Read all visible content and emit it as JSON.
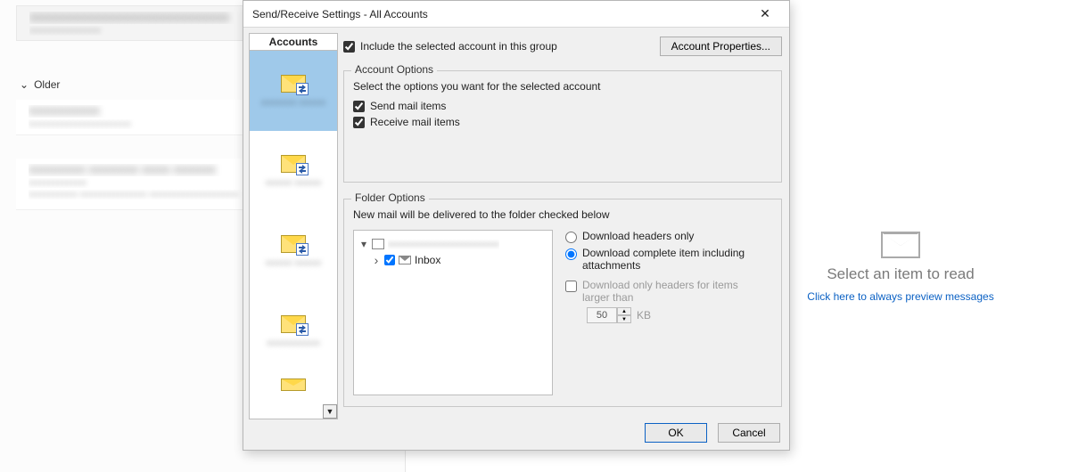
{
  "message_list": {
    "older_label": "Older"
  },
  "reader_pane": {
    "title": "Select an item to read",
    "preview_link": "Click here to always preview messages"
  },
  "dialog": {
    "title": "Send/Receive Settings - All Accounts",
    "accounts_header": "Accounts",
    "include_label": "Include the selected account in this group",
    "account_props_btn": "Account Properties...",
    "account_options": {
      "legend": "Account Options",
      "hint": "Select the options you want for the selected account",
      "send_label": "Send mail items",
      "receive_label": "Receive mail items"
    },
    "folder_options": {
      "legend": "Folder Options",
      "hint": "New mail will be delivered to the folder checked below",
      "inbox_label": "Inbox",
      "radio_headers_only": "Download headers only",
      "radio_complete": "Download complete item including attachments",
      "chk_large_headers": "Download only headers for items larger than",
      "kb_value": "50",
      "kb_unit": "KB"
    },
    "footer": {
      "ok": "OK",
      "cancel": "Cancel"
    }
  }
}
